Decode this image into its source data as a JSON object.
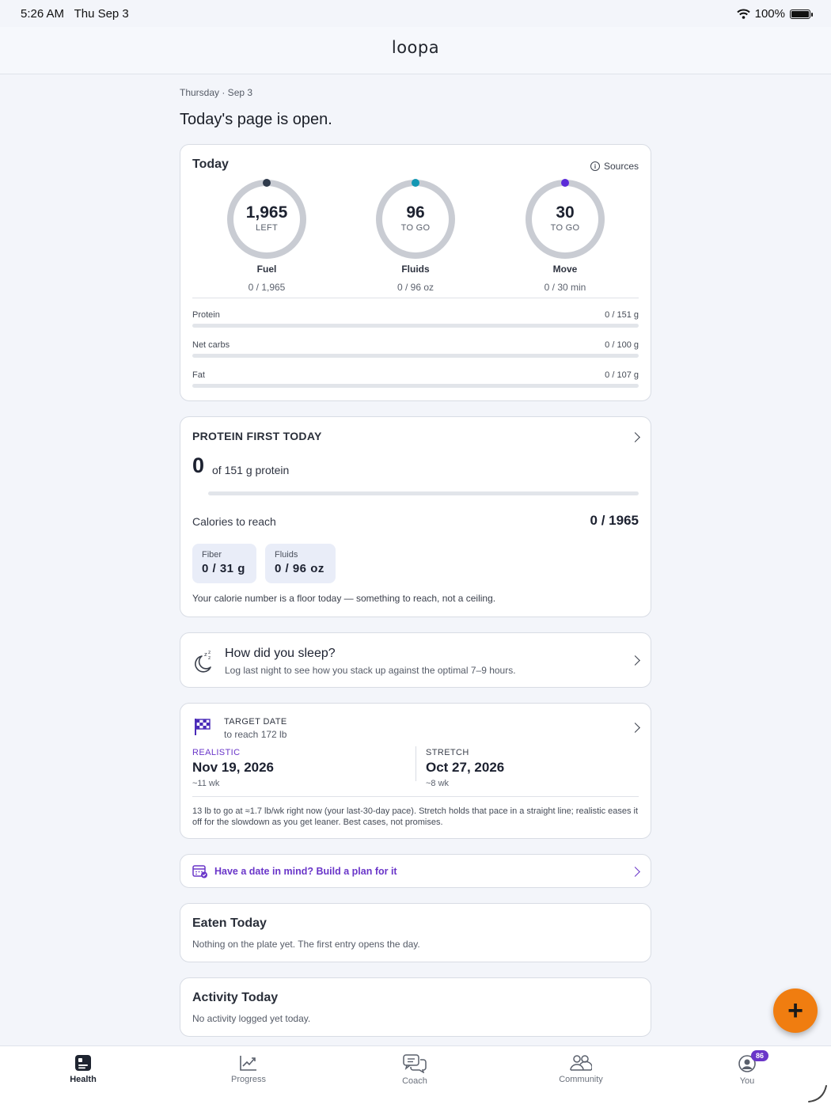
{
  "status_bar": {
    "time": "5:26 AM",
    "date": "Thu Sep 3",
    "battery": "100%"
  },
  "header": {
    "logo": "loopa"
  },
  "page": {
    "date_line": "Thursday · Sep 3",
    "headline": "Today's page is open."
  },
  "today": {
    "title": "Today",
    "sources_label": "Sources",
    "rings": [
      {
        "value": "1,965",
        "sub": "LEFT",
        "label": "Fuel",
        "detail": "0 / 1,965",
        "dot_color": "#2f3a4b"
      },
      {
        "value": "96",
        "sub": "TO GO",
        "label": "Fluids",
        "detail": "0 / 96 oz",
        "dot_color": "#1397b3"
      },
      {
        "value": "30",
        "sub": "TO GO",
        "label": "Move",
        "detail": "0 / 30 min",
        "dot_color": "#5b2bd8"
      }
    ],
    "macros": [
      {
        "name": "Protein",
        "value": "0 / 151 g"
      },
      {
        "name": "Net carbs",
        "value": "0 / 100 g"
      },
      {
        "name": "Fat",
        "value": "0 / 107 g"
      }
    ]
  },
  "protein_first": {
    "title": "PROTEIN FIRST TODAY",
    "current": "0",
    "of_text": "of 151 g protein",
    "calories_label": "Calories to reach",
    "calories_value": "0 / 1965",
    "pills": [
      {
        "label": "Fiber",
        "value": "0 / 31 g"
      },
      {
        "label": "Fluids",
        "value": "0 / 96 oz"
      }
    ],
    "note": "Your calorie number is a floor today — something to reach, not a ceiling."
  },
  "sleep": {
    "title": "How did you sleep?",
    "subtitle": "Log last night to see how you stack up against the optimal 7–9 hours."
  },
  "target": {
    "title": "TARGET DATE",
    "subtitle": "to reach 172 lb",
    "realistic": {
      "kind": "REALISTIC",
      "date": "Nov 19, 2026",
      "weeks": "~11 wk",
      "color": "#6a36c9"
    },
    "stretch": {
      "kind": "STRETCH",
      "date": "Oct 27, 2026",
      "weeks": "~8 wk",
      "color": "#3a3f4b"
    },
    "note": "13 lb to go at ≈1.7 lb/wk right now (your last-30-day pace). Stretch holds that pace in a straight line; realistic eases it off for the slowdown as you get leaner. Best cases, not promises."
  },
  "plan": {
    "label": "Have a date in mind? Build a plan for it"
  },
  "eaten": {
    "title": "Eaten Today",
    "subtitle": "Nothing on the plate yet. The first entry opens the day."
  },
  "activity": {
    "title": "Activity Today",
    "subtitle": "No activity logged yet today."
  },
  "fab": {
    "label": "+"
  },
  "tabs": [
    {
      "label": "Health",
      "icon": "health-icon"
    },
    {
      "label": "Progress",
      "icon": "chart-line-icon"
    },
    {
      "label": "Coach",
      "icon": "chat-bubbles-icon"
    },
    {
      "label": "Community",
      "icon": "people-icon"
    },
    {
      "label": "You",
      "icon": "user-circle-icon",
      "badge": "86"
    }
  ],
  "colors": {
    "accent": "#6a36c9",
    "fab": "#f07d10",
    "ring_track": "#c9ccd3"
  }
}
